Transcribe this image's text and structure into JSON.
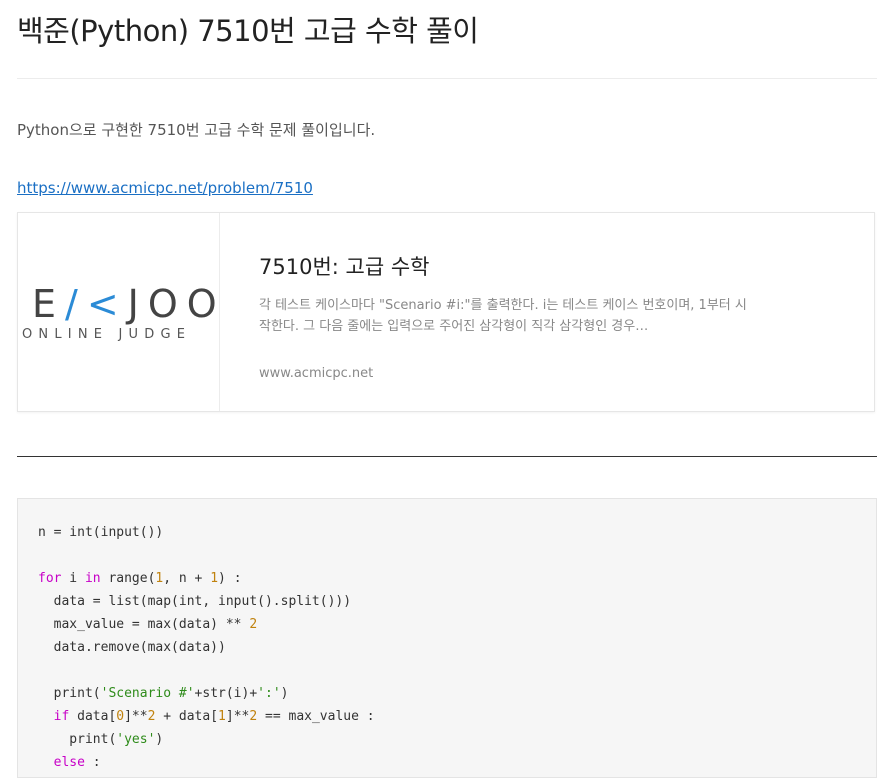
{
  "post": {
    "title": "백준(Python) 7510번 고급 수학 풀이",
    "intro": "Python으로 구현한 7510번 고급 수학 문제 풀이입니다.",
    "link": "https://www.acmicpc.net/problem/7510"
  },
  "card": {
    "logo_main_left": "E",
    "logo_main_k": "/<",
    "logo_main_right": "JOO",
    "logo_sub": "ONLINE JUDGE",
    "title": "7510번: 고급 수학",
    "description": "각 테스트 케이스마다 \"Scenario #i:\"를 출력한다. i는 테스트 케이스 번호이며, 1부터 시작한다. 그 다음 줄에는 입력으로 주어진 삼각형이 직각 삼각형인 경우…",
    "domain": "www.acmicpc.net"
  },
  "code": {
    "lines": [
      [
        {
          "t": "n = int(input())"
        }
      ],
      [],
      [
        {
          "t": "for",
          "c": "kw"
        },
        {
          "t": " i "
        },
        {
          "t": "in",
          "c": "kw"
        },
        {
          "t": " range("
        },
        {
          "t": "1",
          "c": "num"
        },
        {
          "t": ", n + "
        },
        {
          "t": "1",
          "c": "num"
        },
        {
          "t": ") :"
        }
      ],
      [
        {
          "t": "  data = list(map(int, input().split()))"
        }
      ],
      [
        {
          "t": "  max_value = max(data) ** "
        },
        {
          "t": "2",
          "c": "num"
        }
      ],
      [
        {
          "t": "  data.remove(max(data))"
        }
      ],
      [],
      [
        {
          "t": "  print("
        },
        {
          "t": "'Scenario #'",
          "c": "str"
        },
        {
          "t": "+str(i)+"
        },
        {
          "t": "':'",
          "c": "str"
        },
        {
          "t": ")"
        }
      ],
      [
        {
          "t": "  "
        },
        {
          "t": "if",
          "c": "kw"
        },
        {
          "t": " data["
        },
        {
          "t": "0",
          "c": "num"
        },
        {
          "t": "]**"
        },
        {
          "t": "2",
          "c": "num"
        },
        {
          "t": " + data["
        },
        {
          "t": "1",
          "c": "num"
        },
        {
          "t": "]**"
        },
        {
          "t": "2",
          "c": "num"
        },
        {
          "t": " == max_value :"
        }
      ],
      [
        {
          "t": "    print("
        },
        {
          "t": "'yes'",
          "c": "str"
        },
        {
          "t": ")"
        }
      ],
      [
        {
          "t": "  "
        },
        {
          "t": "else",
          "c": "kw"
        },
        {
          "t": " :"
        }
      ]
    ]
  }
}
